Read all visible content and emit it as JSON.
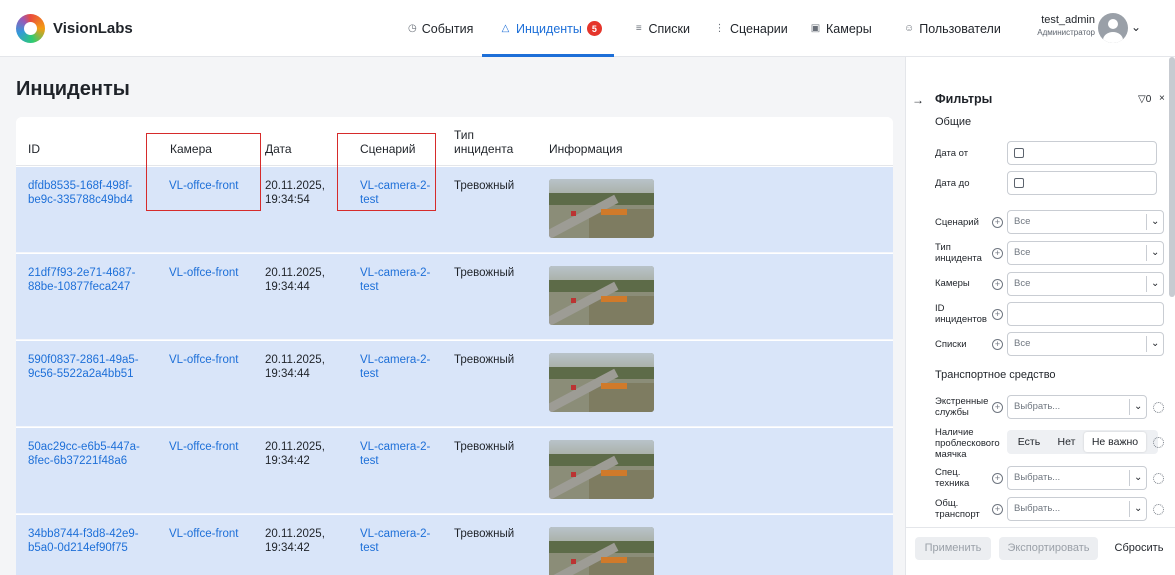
{
  "app": {
    "logo_text": "VisionLabs"
  },
  "nav": [
    {
      "label": "События",
      "icon": "clock-icon"
    },
    {
      "label": "Инциденты",
      "icon": "warning-icon",
      "badge": "5",
      "active": true
    },
    {
      "label": "Списки",
      "icon": "list-icon"
    },
    {
      "label": "Сценарии",
      "icon": "sliders-icon"
    },
    {
      "label": "Камеры",
      "icon": "camera-icon"
    },
    {
      "label": "Пользователи",
      "icon": "users-icon"
    }
  ],
  "user": {
    "name": "test_admin",
    "role": "Администратор"
  },
  "page": {
    "title": "Инциденты"
  },
  "table": {
    "headers": {
      "id": "ID",
      "camera": "Камера",
      "date": "Дата",
      "scenario": "Сценарий",
      "type_line1": "Тип",
      "type_line2": "инцидента",
      "info": "Информация"
    },
    "rows": [
      {
        "id_line1": "dfdb8535-168f-498f-",
        "id_line2": "be9c-335788c49bd4",
        "camera": "VL-offce-front",
        "date": "20.11.2025,",
        "time": "19:34:54",
        "scenario_line1": "VL-camera-2-",
        "scenario_line2": "test",
        "type": "Тревожный"
      },
      {
        "id_line1": "21df7f93-2e71-4687-",
        "id_line2": "88be-10877feca247",
        "camera": "VL-offce-front",
        "date": "20.11.2025,",
        "time": "19:34:44",
        "scenario_line1": "VL-camera-2-",
        "scenario_line2": "test",
        "type": "Тревожный"
      },
      {
        "id_line1": "590f0837-2861-49a5-",
        "id_line2": "9c56-5522a2a4bb51",
        "camera": "VL-offce-front",
        "date": "20.11.2025,",
        "time": "19:34:44",
        "scenario_line1": "VL-camera-2-",
        "scenario_line2": "test",
        "type": "Тревожный"
      },
      {
        "id_line1": "50ac29cc-e6b5-447a-",
        "id_line2": "8fec-6b37221f48a6",
        "camera": "VL-offce-front",
        "date": "20.11.2025,",
        "time": "19:34:42",
        "scenario_line1": "VL-camera-2-",
        "scenario_line2": "test",
        "type": "Тревожный"
      },
      {
        "id_line1": "34bb8744-f3d8-42e9-",
        "id_line2": "b5a0-0d214ef90f75",
        "camera": "VL-offce-front",
        "date": "20.11.2025,",
        "time": "19:34:42",
        "scenario_line1": "VL-camera-2-",
        "scenario_line2": "test",
        "type": "Тревожный"
      }
    ]
  },
  "filters": {
    "title": "Фильтры",
    "active_count": "0",
    "general_title": "Общие",
    "date_from_label": "Дата от",
    "date_to_label": "Дата до",
    "scenario_label": "Сценарий",
    "scenario_value": "Все",
    "incident_type_label_1": "Тип",
    "incident_type_label_2": "инцидента",
    "incident_type_value": "Все",
    "cameras_label": "Камеры",
    "cameras_value": "Все",
    "incident_ids_label_1": "ID",
    "incident_ids_label_2": "инцидентов",
    "lists_label": "Списки",
    "lists_value": "Все",
    "vehicle_title": "Транспортное средство",
    "emergency_label_1": "Экстренные",
    "emergency_label_2": "службы",
    "emergency_placeholder": "Выбрать...",
    "beacon_label_1": "Наличие",
    "beacon_label_2": "проблескового",
    "beacon_label_3": "маячка",
    "beacon_options": [
      "Есть",
      "Нет",
      "Не важно"
    ],
    "beacon_selected": "Не важно",
    "special_label_1": "Спец.",
    "special_label_2": "техника",
    "special_placeholder": "Выбрать...",
    "public_label_1": "Общ.",
    "public_label_2": "транспорт",
    "public_placeholder": "Выбрать...",
    "apply_label": "Применить",
    "export_label": "Экспортировать",
    "reset_label": "Сбросить"
  }
}
